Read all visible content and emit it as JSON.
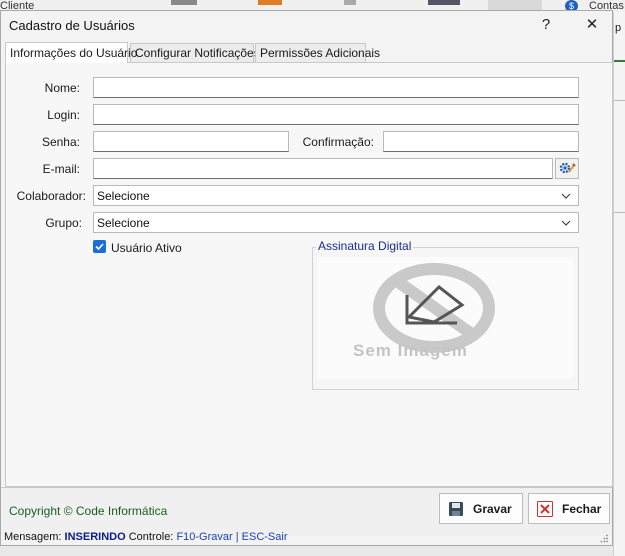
{
  "background": {
    "left_text": "Cliente",
    "right_text": "Contas",
    "right_text2": "p"
  },
  "dialog": {
    "title": "Cadastro de Usuários",
    "help": "?",
    "close": "✕"
  },
  "tabs": [
    {
      "label": "Informações do Usuário",
      "active": true
    },
    {
      "label": "Configurar Notificações",
      "active": false
    },
    {
      "label": "Permissões Adicionais",
      "active": false
    }
  ],
  "form": {
    "nome_label": "Nome:",
    "nome_value": "",
    "login_label": "Login:",
    "login_value": "",
    "senha_label": "Senha:",
    "senha_value": "",
    "confirmacao_label": "Confirmação:",
    "confirmacao_value": "",
    "email_label": "E-mail:",
    "email_value": "",
    "colaborador_label": "Colaborador:",
    "colaborador_value": "Selecione",
    "grupo_label": "Grupo:",
    "grupo_value": "Selecione",
    "ativo_label": "Usuário Ativo",
    "ativo_checked": true
  },
  "signature": {
    "legend": "Assinatura Digital",
    "no_image_text": "Sem Imagem"
  },
  "footer": {
    "copyright": "Copyright © Code Informática",
    "save_label": "Gravar",
    "close_label": "Fechar"
  },
  "status": {
    "mensagem_label": "Mensagem:",
    "mensagem_value": "INSERINDO",
    "controle_label": "Controle:",
    "controle_value": "F10-Gravar | ESC-Sair"
  },
  "colors": {
    "accent": "#1a6fd6",
    "copyright": "#1b5e20",
    "legend": "#1b2c8f",
    "close_icon": "#d32f2f"
  }
}
